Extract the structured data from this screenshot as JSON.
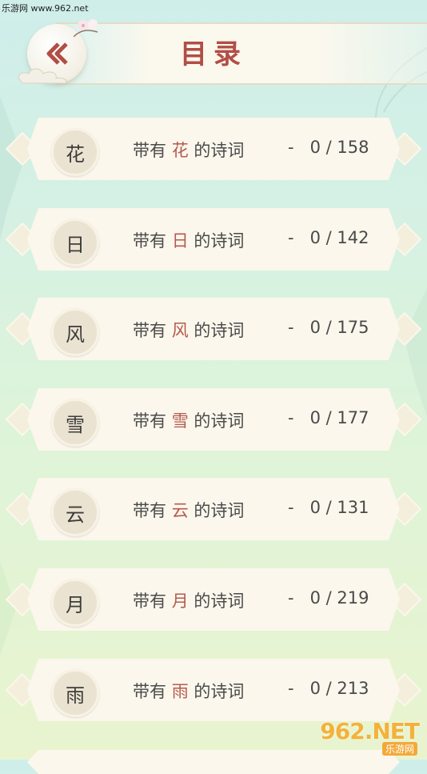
{
  "watermark": {
    "top": "乐游网 www.962.net",
    "brand": "962.NET",
    "brand_cn": "乐游网"
  },
  "header": {
    "title": "目录"
  },
  "list": {
    "prefix": "带有",
    "suffix": "的诗词",
    "separator": "-",
    "items": [
      {
        "char": "花",
        "count": "0 / 158"
      },
      {
        "char": "日",
        "count": "0 / 142"
      },
      {
        "char": "风",
        "count": "0 / 175"
      },
      {
        "char": "雪",
        "count": "0 / 177"
      },
      {
        "char": "云",
        "count": "0 / 131"
      },
      {
        "char": "月",
        "count": "0 / 219"
      },
      {
        "char": "雨",
        "count": "0 / 213"
      }
    ]
  },
  "colors": {
    "title": "#b14e45",
    "highlight": "#b55a4e",
    "card": "#fbf7ec"
  }
}
